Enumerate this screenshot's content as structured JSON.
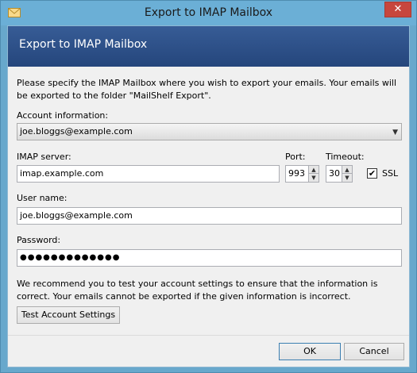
{
  "window": {
    "title": "Export to IMAP Mailbox",
    "close_glyph": "✕"
  },
  "banner": {
    "title": "Export to IMAP Mailbox"
  },
  "form": {
    "description": "Please specify the IMAP Mailbox where you wish to export your emails. Your emails will be exported to the folder \"MailShelf Export\".",
    "account_label": "Account information:",
    "account_value": "joe.bloggs@example.com",
    "imap_label": "IMAP server:",
    "imap_value": "imap.example.com",
    "port_label": "Port:",
    "port_value": "993",
    "timeout_label": "Timeout:",
    "timeout_value": "30",
    "ssl_label": "SSL",
    "ssl_checked": true,
    "username_label": "User name:",
    "username_value": "joe.bloggs@example.com",
    "password_label": "Password:",
    "password_value": "●●●●●●●●●●●●●",
    "recommend_text": "We recommend you to test your account settings to ensure that the information is correct. Your emails cannot be exported if the given information is incorrect.",
    "test_button": "Test Account Settings"
  },
  "footer": {
    "ok_button": "OK",
    "cancel_button": "Cancel"
  },
  "icons": {
    "title_icon": "envelope-icon",
    "spin_up": "▲",
    "spin_down": "▼",
    "dropdown": "▼",
    "checkmark": "✔"
  }
}
